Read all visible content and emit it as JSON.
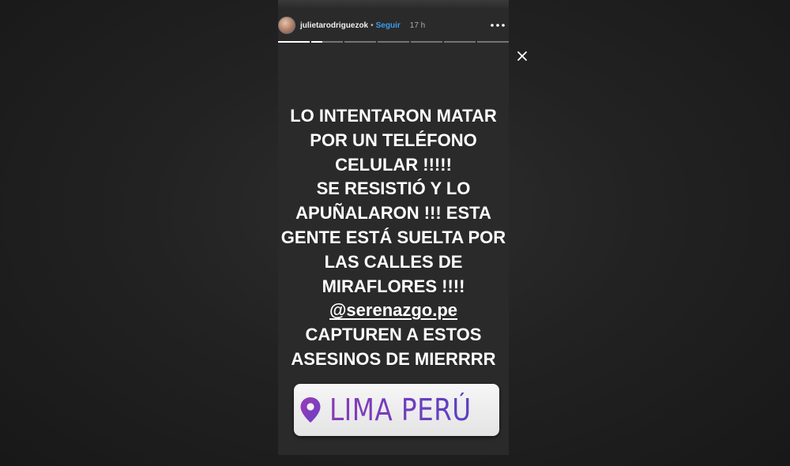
{
  "header": {
    "username": "julietarodriguezok",
    "separator": "•",
    "follow_label": "Seguir",
    "time": "17 h",
    "more_icon": "more-dots-icon",
    "close_icon": "close-icon"
  },
  "progress": {
    "segments": [
      1.0,
      0.35,
      0,
      0,
      0,
      0,
      0
    ]
  },
  "story": {
    "lines": [
      "LO INTENTARON MATAR",
      "POR UN TELÉFONO",
      "CELULAR !!!!!",
      "SE RESISTIÓ Y LO",
      "APUÑALARON !!! ESTA",
      "GENTE ESTÁ SUELTA POR",
      "LAS CALLES DE",
      "MIRAFLORES !!!!"
    ],
    "mention": "@serenazgo.pe",
    "lines_after": [
      "CAPTUREN A ESTOS",
      "ASESINOS DE MIERRRR"
    ]
  },
  "location_sticker": {
    "icon": "location-pin-icon",
    "label": "LIMA PERÚ"
  },
  "colors": {
    "follow": "#3d9be9",
    "sticker_text": "#6e3dc0",
    "story_bg": "#2a2a2a"
  }
}
